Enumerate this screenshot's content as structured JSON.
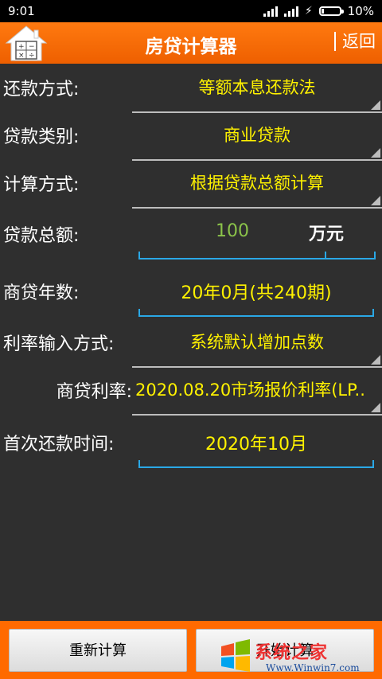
{
  "status": {
    "time": "9:01",
    "battery": "10%",
    "battery_level": 0.1
  },
  "header": {
    "title": "房贷计算器",
    "back_label": "返回"
  },
  "form": {
    "repay_method": {
      "label": "还款方式:",
      "value": "等额本息还款法"
    },
    "loan_type": {
      "label": "贷款类别:",
      "value": "商业贷款"
    },
    "calc_method": {
      "label": "计算方式:",
      "value": "根据贷款总额计算"
    },
    "loan_amount": {
      "label": "贷款总额:",
      "value": "100",
      "unit": "万元"
    },
    "loan_years": {
      "label": "商贷年数:",
      "value": "20年0月(共240期)"
    },
    "rate_input_method": {
      "label": "利率输入方式:",
      "value": "系统默认增加点数"
    },
    "loan_rate": {
      "label": "商贷利率:",
      "value": "2020.08.20市场报价利率(LP.."
    },
    "first_repay_time": {
      "label": "首次还款时间:",
      "value": "2020年10月"
    }
  },
  "footer": {
    "reset_label": "重新计算",
    "start_label": "开始计算"
  },
  "watermark": {
    "text": "系统之家",
    "url": "Www.Winwin7.com"
  },
  "colors": {
    "accent": "#ff6a00",
    "value": "#fff200",
    "amount": "#8bc34a",
    "field_line": "#2aa8e6"
  }
}
